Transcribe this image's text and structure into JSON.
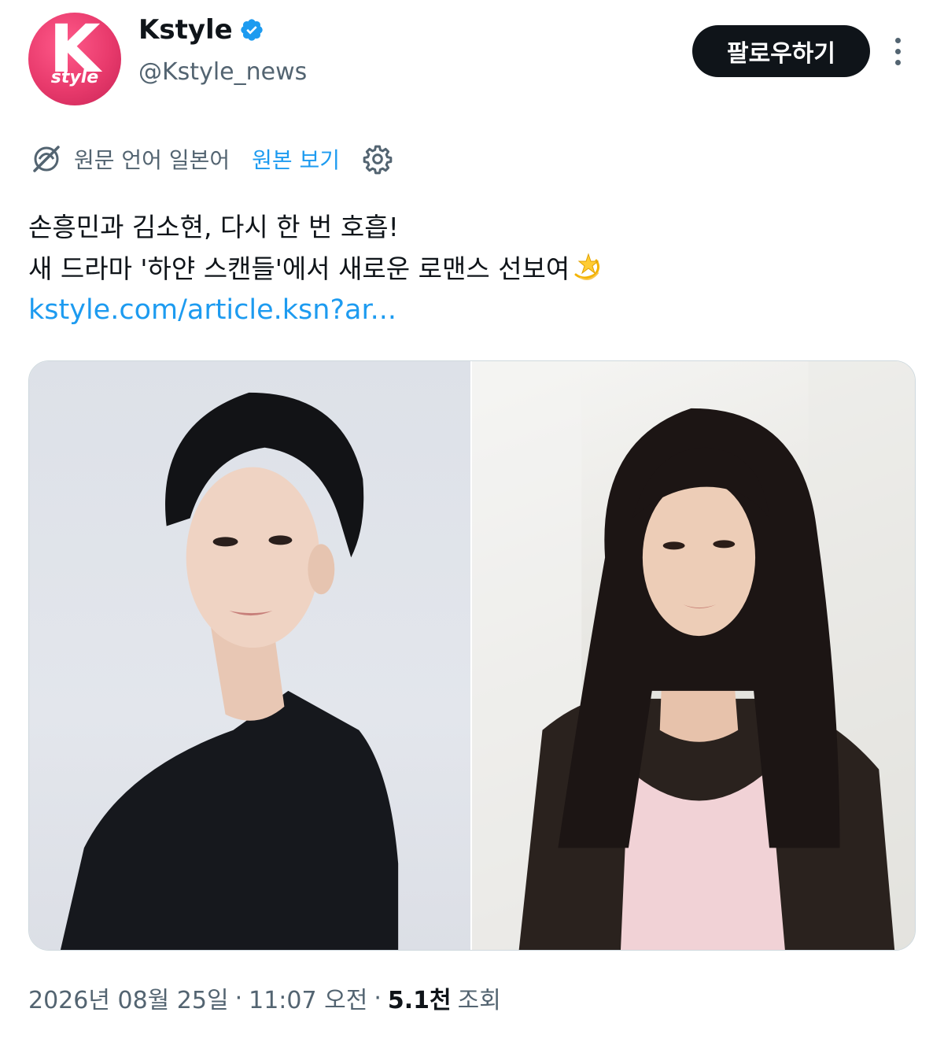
{
  "header": {
    "avatar_letter": "K",
    "avatar_sub": "style",
    "display_name": "Kstyle",
    "handle": "@Kstyle_news",
    "follow_label": "팔로우하기"
  },
  "translation": {
    "language_label": "원문 언어 일본어",
    "show_original_label": "원본 보기"
  },
  "tweet": {
    "line1": "손흥민과 김소현, 다시 한 번 호흡!",
    "line2": "새 드라마 '하얀 스캔들'에서 새로운 로맨스 선보여",
    "link_text": "kstyle.com/article.ksn?ar..."
  },
  "meta": {
    "date": "2026년 08월 25일",
    "separator": "·",
    "time": "11:07 오전",
    "views_count": "5.1천",
    "views_label": "조회"
  },
  "icons": {
    "verified": "verified-badge-icon",
    "more": "more-dots-icon",
    "translate": "translate-globe-icon",
    "settings": "gear-icon",
    "emoji": "dizzy-star-emoji"
  },
  "colors": {
    "brand_avatar": "#e83a6c",
    "link": "#1d9bf0",
    "follow_button_bg": "#0f1419",
    "secondary_text": "#536471"
  }
}
